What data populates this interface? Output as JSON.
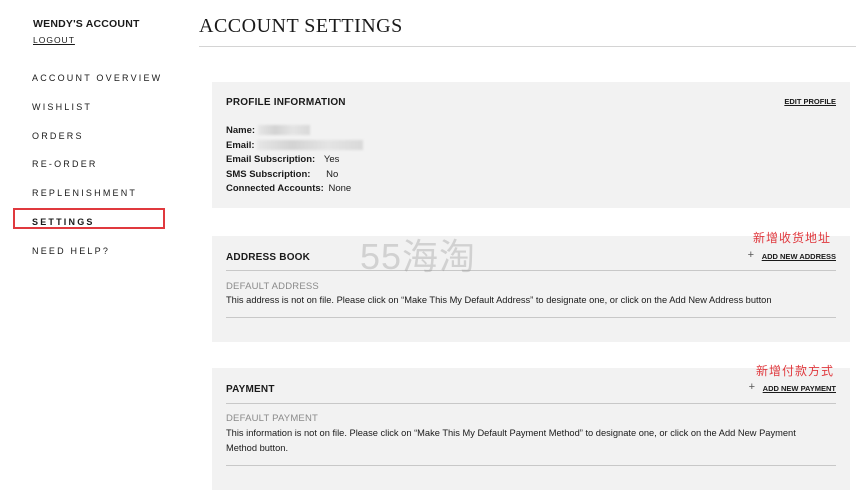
{
  "sidebar": {
    "account_title": "WENDY'S ACCOUNT",
    "logout": "LOGOUT",
    "items": [
      {
        "label": "ACCOUNT OVERVIEW"
      },
      {
        "label": "WISHLIST"
      },
      {
        "label": "ORDERS"
      },
      {
        "label": "RE-ORDER"
      },
      {
        "label": "REPLENISHMENT"
      },
      {
        "label": "SETTINGS"
      },
      {
        "label": "NEED HELP?"
      }
    ],
    "active_item": "SETTINGS"
  },
  "page_title": "ACCOUNT SETTINGS",
  "profile": {
    "heading": "PROFILE INFORMATION",
    "edit_link": "EDIT PROFILE",
    "name_label": "Name:",
    "email_label": "Email:",
    "email_sub_label": "Email Subscription:",
    "email_sub_value": "Yes",
    "sms_sub_label": "SMS Subscription:",
    "sms_sub_value": "No",
    "connected_label": "Connected Accounts:",
    "connected_value": "None"
  },
  "address_book": {
    "heading": "ADDRESS BOOK",
    "add_link": "ADD NEW ADDRESS",
    "sub_heading": "DEFAULT ADDRESS",
    "message": "This address is not on file. Please click on “Make This My Default Address” to designate one, or click on the Add New Address button"
  },
  "payment": {
    "heading": "PAYMENT",
    "add_link": "ADD NEW PAYMENT",
    "sub_heading": "DEFAULT PAYMENT",
    "message": "This information is not on file. Please click on “Make This My Default Payment Method” to designate one, or click on the Add New Payment Method button."
  },
  "annotations": {
    "address": "新增收货地址",
    "payment": "新增付款方式"
  },
  "watermark": "55海淘",
  "colors": {
    "panel_bg": "#f2f2f2",
    "highlight_red": "#e0393e",
    "text": "#1a1a1a",
    "muted": "#8a8a8a"
  }
}
